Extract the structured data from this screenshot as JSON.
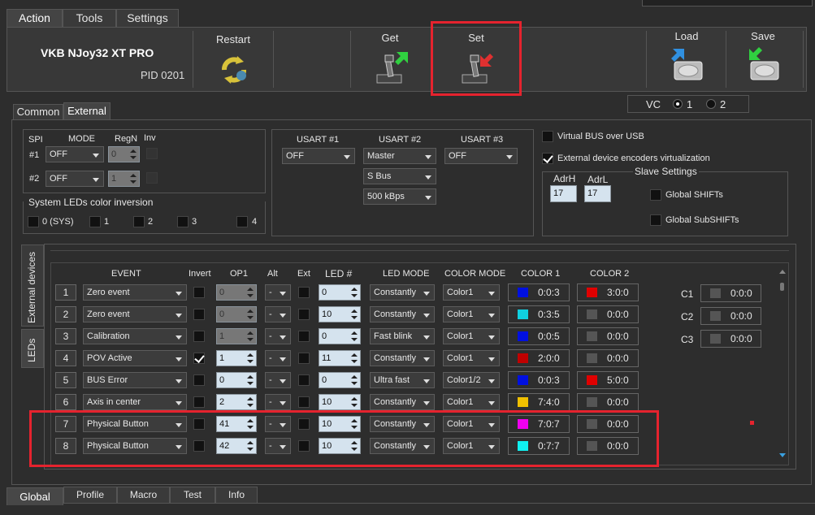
{
  "top_tabs": [
    "Action",
    "Tools",
    "Settings"
  ],
  "device": {
    "name": "VKB NJoy32 XT PRO",
    "pid": "PID 0201"
  },
  "toolbar": {
    "restart": "Restart",
    "get": "Get",
    "set": "Set",
    "load": "Load",
    "save": "Save"
  },
  "sub_tabs": [
    "Common",
    "External"
  ],
  "vc": {
    "label": "VC",
    "opt1": "1",
    "opt2": "2"
  },
  "spi": {
    "header": "SPI",
    "mode": "MODE",
    "regn": "RegN",
    "inv": "Inv",
    "rows": [
      {
        "id": "#1",
        "mode": "OFF",
        "regn": "0"
      },
      {
        "id": "#2",
        "mode": "OFF",
        "regn": "1"
      }
    ]
  },
  "sysleds": {
    "title": "System LEDs color inversion",
    "items": [
      "0 (SYS)",
      "1",
      "2",
      "3",
      "4"
    ]
  },
  "usart": {
    "h1": "USART #1",
    "h2": "USART #2",
    "h3": "USART #3",
    "u1": "OFF",
    "u2": "Master",
    "u2bus": "S Bus",
    "u2speed": "500 kBps",
    "u3": "OFF"
  },
  "options": {
    "vbus": "Virtual BUS over USB",
    "extenc": "External device encoders virtualization"
  },
  "slave": {
    "title": "Slave Settings",
    "adrh_label": "AdrH",
    "adrl_label": "AdrL",
    "adrh": "17",
    "adrl": "17",
    "shifts": "Global SHIFTs",
    "subshifts": "Global SubSHIFTs"
  },
  "side_tabs": {
    "ext": "External devices",
    "leds": "LEDs"
  },
  "table": {
    "headers": {
      "event": "EVENT",
      "invert": "Invert",
      "op1": "OP1",
      "alt": "Alt",
      "ext": "Ext",
      "led": "LED #",
      "ledmode": "LED MODE",
      "colormode": "COLOR MODE",
      "c1": "COLOR 1",
      "c2": "COLOR 2"
    },
    "rows": [
      {
        "n": "1",
        "event": "Zero event",
        "invert": false,
        "op1": "0",
        "alt": "-",
        "led": "0",
        "mode": "Constantly",
        "cmode": "Color1",
        "c1": "#0010e0",
        "c1v": "0:0:3",
        "c2": "#e00000",
        "c2v": "3:0:0"
      },
      {
        "n": "2",
        "event": "Zero event",
        "invert": false,
        "op1": "0",
        "alt": "-",
        "led": "10",
        "mode": "Constantly",
        "cmode": "Color1",
        "c1": "#10d0e0",
        "c1v": "0:3:5",
        "c2": "#555555",
        "c2v": "0:0:0"
      },
      {
        "n": "3",
        "event": "Calibration",
        "invert": false,
        "op1": "1",
        "alt": "-",
        "led": "0",
        "mode": "Fast blink",
        "cmode": "Color1",
        "c1": "#0010e0",
        "c1v": "0:0:5",
        "c2": "#555555",
        "c2v": "0:0:0"
      },
      {
        "n": "4",
        "event": "POV Active",
        "invert": true,
        "op1": "1",
        "alt": "-",
        "led": "11",
        "mode": "Constantly",
        "cmode": "Color1",
        "c1": "#c00000",
        "c1v": "2:0:0",
        "c2": "#555555",
        "c2v": "0:0:0"
      },
      {
        "n": "5",
        "event": "BUS Error",
        "invert": false,
        "op1": "0",
        "alt": "-",
        "led": "0",
        "mode": "Ultra fast",
        "cmode": "Color1/2",
        "c1": "#0010e0",
        "c1v": "0:0:3",
        "c2": "#e00000",
        "c2v": "5:0:0"
      },
      {
        "n": "6",
        "event": "Axis in center",
        "invert": false,
        "op1": "2",
        "alt": "-",
        "led": "10",
        "mode": "Constantly",
        "cmode": "Color1",
        "c1": "#f0c000",
        "c1v": "7:4:0",
        "c2": "#555555",
        "c2v": "0:0:0"
      },
      {
        "n": "7",
        "event": "Physical Button",
        "invert": false,
        "op1": "41",
        "alt": "-",
        "led": "10",
        "mode": "Constantly",
        "cmode": "Color1",
        "c1": "#f000f0",
        "c1v": "7:0:7",
        "c2": "#555555",
        "c2v": "0:0:0"
      },
      {
        "n": "8",
        "event": "Physical Button",
        "invert": false,
        "op1": "42",
        "alt": "-",
        "led": "10",
        "mode": "Constantly",
        "cmode": "Color1",
        "c1": "#10f0f0",
        "c1v": "0:7:7",
        "c2": "#555555",
        "c2v": "0:0:0"
      }
    ]
  },
  "cvals": [
    {
      "label": "C1",
      "value": "0:0:0"
    },
    {
      "label": "C2",
      "value": "0:0:0"
    },
    {
      "label": "C3",
      "value": "0:0:0"
    }
  ],
  "bottom_tabs": [
    "Global",
    "Profile",
    "Macro",
    "Test",
    "Info"
  ],
  "colors": {
    "highlight": "#e5232e",
    "background": "#2d2d2d"
  }
}
